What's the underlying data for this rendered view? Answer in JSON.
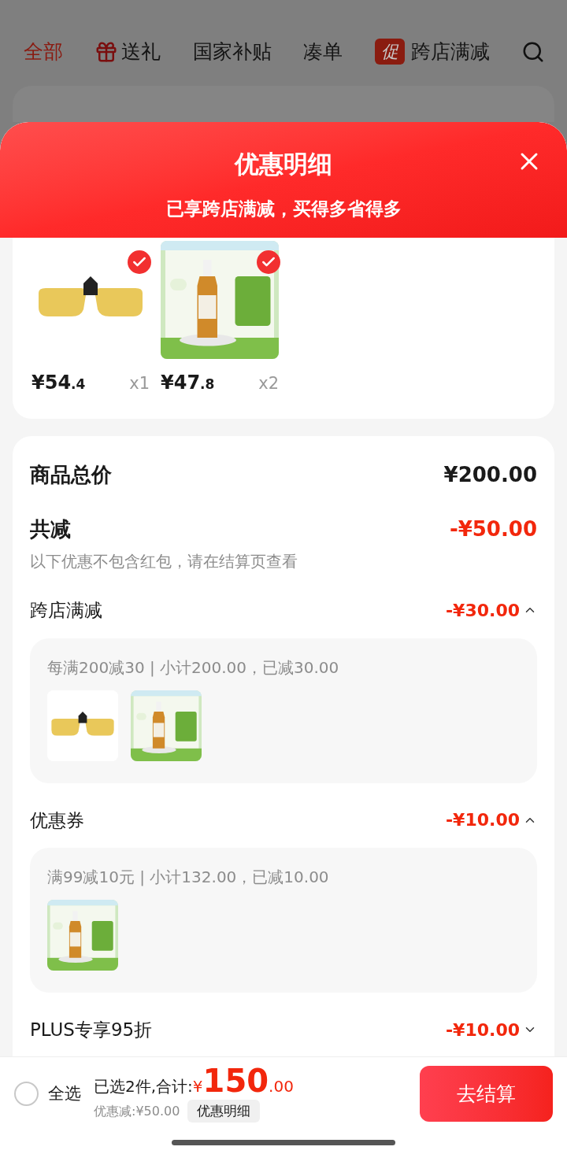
{
  "background_tabs": [
    {
      "label": "全部",
      "selected": true,
      "kind": "text"
    },
    {
      "label": "送礼",
      "selected": false,
      "kind": "gift"
    },
    {
      "label": "国家补贴",
      "selected": false,
      "kind": "text"
    },
    {
      "label": "凑单",
      "selected": false,
      "kind": "text"
    },
    {
      "label": "跨店满减",
      "selected": false,
      "kind": "promo",
      "badge": "促"
    }
  ],
  "sheet": {
    "title": "优惠明细",
    "subtitle": "已享跨店满减，买得多省得多"
  },
  "products": [
    {
      "kind": "glasses",
      "price_main": "¥54",
      "price_decimal": ".4",
      "quantity": "x1",
      "checked": true
    },
    {
      "kind": "bottle",
      "price_main": "¥47",
      "price_decimal": ".8",
      "quantity": "x2",
      "checked": true
    }
  ],
  "summary": {
    "total_label": "商品总价",
    "total": "¥200.00",
    "reduction_label": "共减",
    "reduction": "-¥50.00",
    "note": "以下优惠不包含红包，请在结算页查看"
  },
  "discounts": [
    {
      "name": "跨店满减",
      "amount": "-¥30.00",
      "expanded": true,
      "detail": "每满200减30 | 小计200.00，已减30.00",
      "products": [
        {
          "kind": "glasses"
        },
        {
          "kind": "bottle"
        }
      ]
    },
    {
      "name": "优惠券",
      "amount": "-¥10.00",
      "expanded": true,
      "detail": "满99减10元 | 小计132.00，已减10.00",
      "products": [
        {
          "kind": "bottle"
        }
      ]
    },
    {
      "name": "PLUS专享95折",
      "amount": "-¥10.00",
      "expanded": false
    }
  ],
  "footer": {
    "select_all": {
      "label": "全选",
      "checked": false
    },
    "selected_text": "已选2件,合计:",
    "currency": "¥",
    "total_main": "150",
    "total_decimal": ".00",
    "savings": "优惠减:¥50.00",
    "details_button": "优惠明细",
    "checkout": "去结算"
  }
}
